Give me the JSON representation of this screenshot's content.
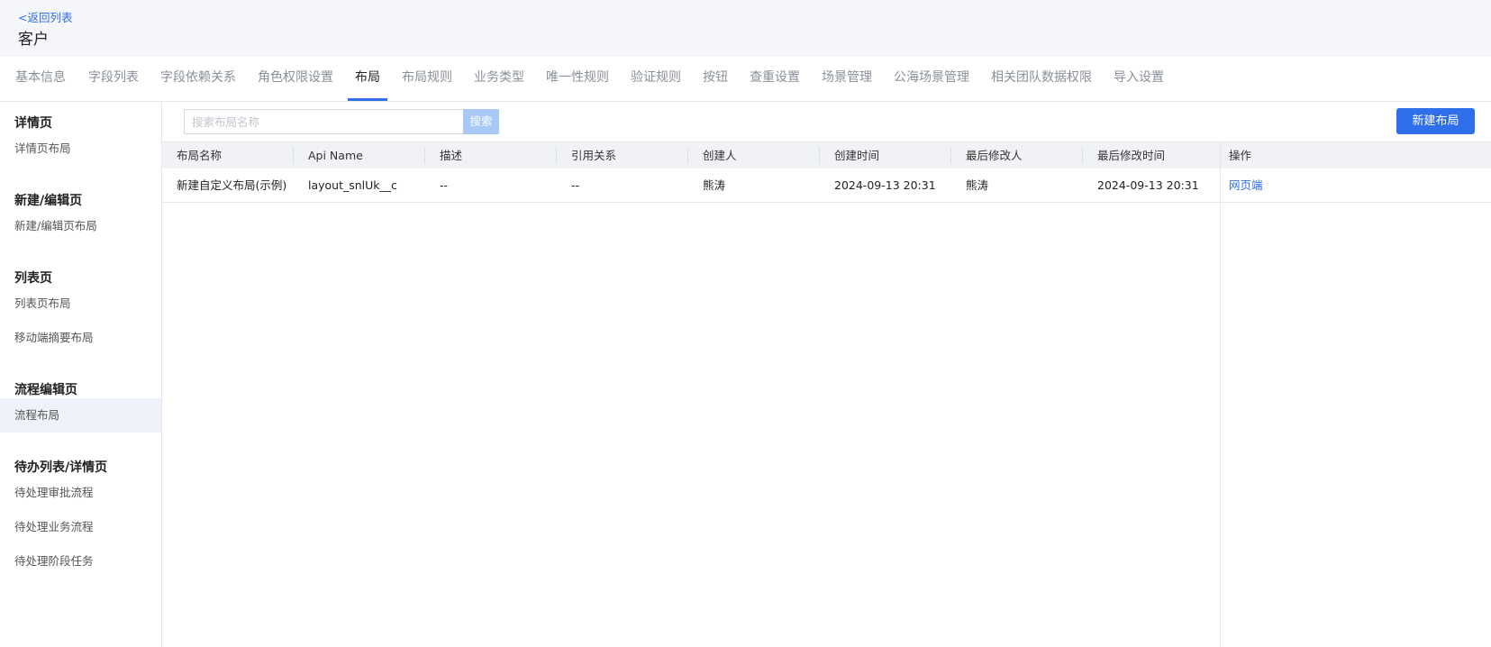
{
  "header": {
    "back_label": "<返回列表",
    "title": "客户"
  },
  "tabs": [
    {
      "label": "基本信息"
    },
    {
      "label": "字段列表"
    },
    {
      "label": "字段依赖关系"
    },
    {
      "label": "角色权限设置"
    },
    {
      "label": "布局",
      "active": true
    },
    {
      "label": "布局规则"
    },
    {
      "label": "业务类型"
    },
    {
      "label": "唯一性规则"
    },
    {
      "label": "验证规则"
    },
    {
      "label": "按钮"
    },
    {
      "label": "查重设置"
    },
    {
      "label": "场景管理"
    },
    {
      "label": "公海场景管理"
    },
    {
      "label": "相关团队数据权限"
    },
    {
      "label": "导入设置"
    }
  ],
  "sidebar": {
    "groups": [
      {
        "title": "详情页",
        "items": [
          {
            "label": "详情页布局"
          }
        ]
      },
      {
        "title": "新建/编辑页",
        "items": [
          {
            "label": "新建/编辑页布局"
          }
        ]
      },
      {
        "title": "列表页",
        "items": [
          {
            "label": "列表页布局"
          },
          {
            "label": "移动端摘要布局"
          }
        ]
      },
      {
        "title": "流程编辑页",
        "items": [
          {
            "label": "流程布局",
            "active": true
          }
        ]
      },
      {
        "title": "待办列表/详情页",
        "items": [
          {
            "label": "待处理审批流程"
          },
          {
            "label": "待处理业务流程"
          },
          {
            "label": "待处理阶段任务"
          }
        ]
      }
    ]
  },
  "toolbar": {
    "search_placeholder": "搜索布局名称",
    "search_label": "搜索",
    "new_label": "新建布局"
  },
  "table": {
    "columns": [
      "布局名称",
      "Api Name",
      "描述",
      "引用关系",
      "创建人",
      "创建时间",
      "最后修改人",
      "最后修改时间",
      "操作"
    ],
    "rows": [
      [
        "新建自定义布局(示例)",
        "layout_snlUk__c",
        "--",
        "--",
        "熊涛",
        "2024-09-13 20:31",
        "熊涛",
        "2024-09-13 20:31",
        "网页端"
      ]
    ]
  },
  "colors": {
    "accent": "#2f6fec",
    "header_bg": "#f4f6f9",
    "active_item_bg": "#eef2fa"
  }
}
